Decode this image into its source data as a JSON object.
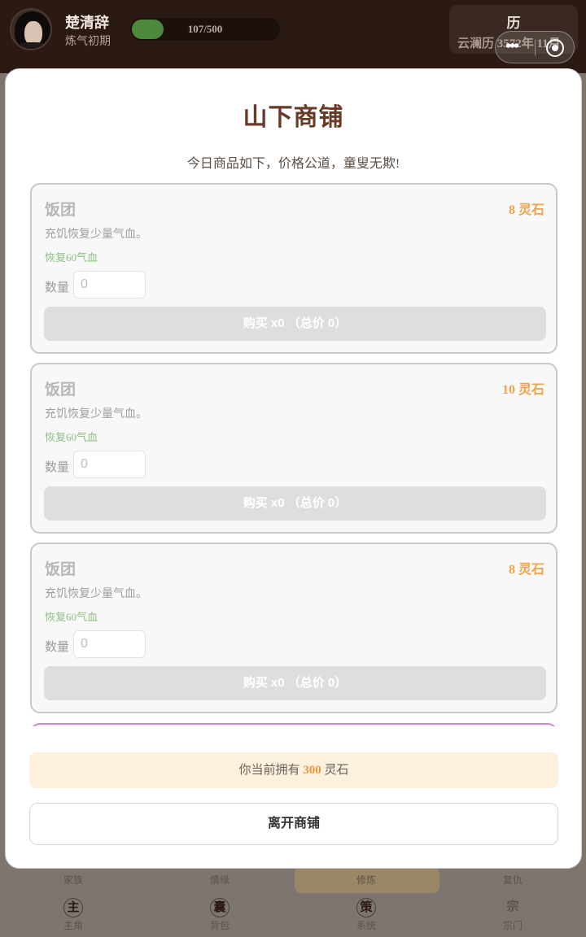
{
  "player": {
    "name": "楚清辞",
    "realm": "炼气初期",
    "hp_text": "107/500",
    "hp_current": 107,
    "hp_max": 500
  },
  "calendar": {
    "char": "历",
    "date": "云澜历 3572年 11月"
  },
  "shop": {
    "title": "山下商铺",
    "subtitle": "今日商品如下，价格公道，童叟无欺!",
    "qty_label": "数量",
    "items": [
      {
        "name": "饭团",
        "price": "8 灵石",
        "desc": "充饥恢复少量气血。",
        "effect": "恢复60气血",
        "qty": "0",
        "buy_label": "购买 x0 （总价 0）"
      },
      {
        "name": "饭团",
        "price": "10 灵石",
        "desc": "充饥恢复少量气血。",
        "effect": "恢复60气血",
        "qty": "0",
        "buy_label": "购买 x0 （总价 0）"
      },
      {
        "name": "饭团",
        "price": "8 灵石",
        "desc": "充饥恢复少量气血。",
        "effect": "恢复60气血",
        "qty": "0",
        "buy_label": "购买 x0 （总价 0）"
      }
    ],
    "balance_prefix": "你当前拥有",
    "balance_amount": "300",
    "balance_unit": "灵石",
    "leave_label": "离开商铺"
  },
  "nav": {
    "row1": [
      {
        "label": "家族"
      },
      {
        "label": "情缘"
      },
      {
        "label": "修炼"
      },
      {
        "label": "复仇"
      }
    ],
    "row2": [
      {
        "glyph": "主",
        "label": "主角"
      },
      {
        "glyph": "囊",
        "label": "背包"
      },
      {
        "glyph": "策",
        "label": "系统"
      },
      {
        "glyph": "宗",
        "label": "宗门"
      }
    ]
  },
  "colors": {
    "accent_title": "#6a3a28",
    "price": "#f0a34b",
    "effect_green": "#8fbf85",
    "balance_bg": "#fdf0dd"
  },
  "icons": {
    "capsule_more": "more-dots-icon",
    "capsule_close": "target-close-icon"
  }
}
